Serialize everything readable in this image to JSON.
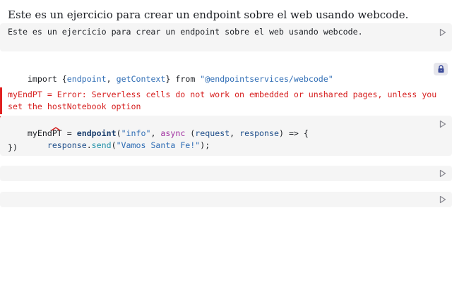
{
  "heading": "Este es un ejercicio para crear un endpoint sobre el web usando webcode.",
  "cells": [
    {
      "source": "Este es un ejercicio para crear un endpoint sobre el web usando webcode.",
      "run_icon": "play-icon"
    },
    {
      "import": {
        "kw_import": "import",
        "brace_open": " {",
        "name1": "endpoint",
        "comma": ", ",
        "name2": "getContext",
        "brace_close": "} ",
        "kw_from": "from",
        "space": " ",
        "module": "\"@endpointservices/webcode\""
      },
      "lock_icon": "lock-icon"
    },
    {
      "error": "myEndPT = Error: Serverless cells do not work on embedded or unshared pages, unless you set the hostNotebook option"
    },
    {
      "line1": {
        "lhs": "myEndPT = ",
        "fn": "endpoint",
        "paren": "(",
        "arg1": "\"info\"",
        "comma": ", ",
        "kw_async": "async",
        "params_open": " (",
        "p1": "request",
        "p_sep": ", ",
        "p2": "response",
        "params_close": ") => {"
      },
      "line2": {
        "indent": "    ",
        "obj": "response",
        "dot": ".",
        "method": "send",
        "paren_open": "(",
        "arg": "\"Vamos Santa Fe!\"",
        "paren_close": ");"
      },
      "line3": "})",
      "run_icon": "play-icon"
    },
    {
      "run_icon": "play-icon"
    },
    {
      "run_icon": "play-icon"
    }
  ],
  "colors": {
    "cell_bg": "#f5f5f5",
    "error": "#d61f1f",
    "string": "#2f6db5",
    "keyword": "#a02fa0"
  }
}
